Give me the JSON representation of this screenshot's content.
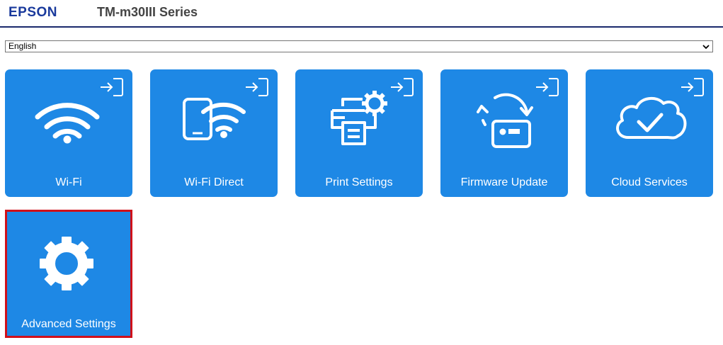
{
  "header": {
    "brand": "EPSON",
    "model": "TM-m30III Series"
  },
  "language": {
    "selected": "English"
  },
  "tiles": [
    {
      "label": "Wi-Fi",
      "icon": "wifi-icon"
    },
    {
      "label": "Wi-Fi Direct",
      "icon": "wifi-direct-icon"
    },
    {
      "label": "Print Settings",
      "icon": "print-settings-icon"
    },
    {
      "label": "Firmware Update",
      "icon": "firmware-update-icon"
    },
    {
      "label": "Cloud Services",
      "icon": "cloud-check-icon"
    },
    {
      "label": "Advanced Settings",
      "icon": "gear-icon",
      "selected": true
    }
  ],
  "colors": {
    "tile": "#1e88e5",
    "brand": "#1a3a9c",
    "selection_outline": "#d0101a"
  }
}
